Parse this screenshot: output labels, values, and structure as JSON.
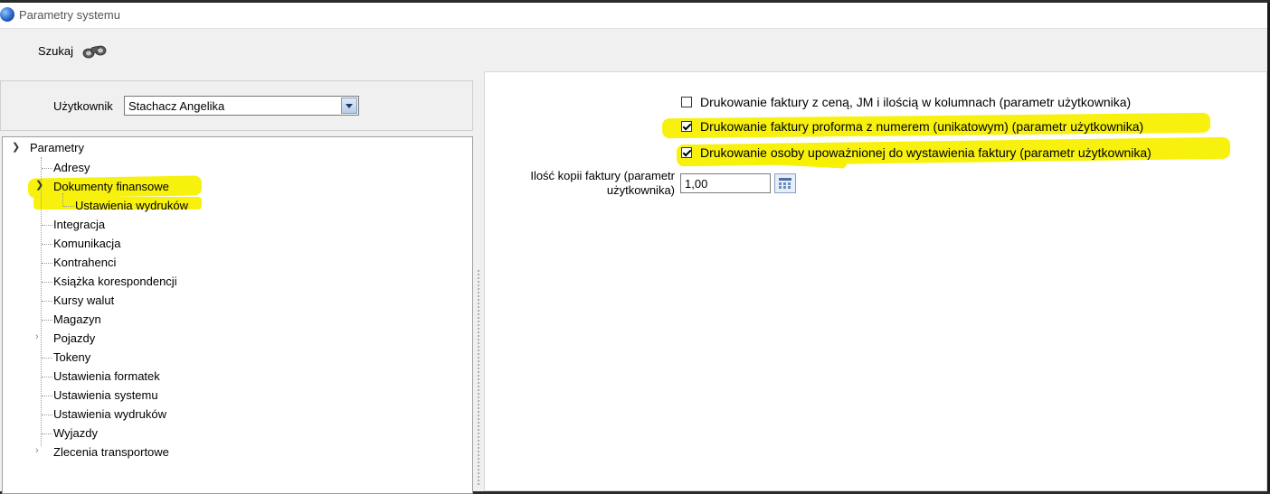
{
  "window": {
    "title": "Parametry systemu"
  },
  "search": {
    "label": "Szukaj",
    "icon": "binoculars-icon"
  },
  "user": {
    "label": "Użytkownik",
    "value": "Stachacz Angelika"
  },
  "tree": {
    "root": "Parametry",
    "items": [
      {
        "label": "Adresy"
      },
      {
        "label": "Dokumenty finansowe",
        "expanded": true,
        "children": [
          {
            "label": "Ustawienia wydruków"
          }
        ]
      },
      {
        "label": "Integracja"
      },
      {
        "label": "Komunikacja"
      },
      {
        "label": "Kontrahenci"
      },
      {
        "label": "Książka korespondencji"
      },
      {
        "label": "Kursy walut"
      },
      {
        "label": "Magazyn"
      },
      {
        "label": "Pojazdy",
        "collapsed": true
      },
      {
        "label": "Tokeny"
      },
      {
        "label": "Ustawienia formatek"
      },
      {
        "label": "Ustawienia systemu"
      },
      {
        "label": "Ustawienia wydruków"
      },
      {
        "label": "Wyjazdy"
      },
      {
        "label": "Zlecenia transportowe",
        "collapsed": true
      }
    ]
  },
  "settings": {
    "checkboxes": [
      {
        "label": "Drukowanie faktury z ceną, JM i ilością w kolumnach (parametr użytkownika)",
        "checked": false
      },
      {
        "label": "Drukowanie faktury proforma z numerem (unikatowym) (parametr użytkownika)",
        "checked": true
      },
      {
        "label": "Drukowanie osoby upoważnionej do wystawienia faktury (parametr użytkownika)",
        "checked": true
      }
    ],
    "copies": {
      "label_line1": "Ilość kopii faktury (parametr",
      "label_line2": "użytkownika)",
      "value": "1,00"
    }
  },
  "colors": {
    "highlight": "#f7f000",
    "panel": "#f0f0f0"
  }
}
